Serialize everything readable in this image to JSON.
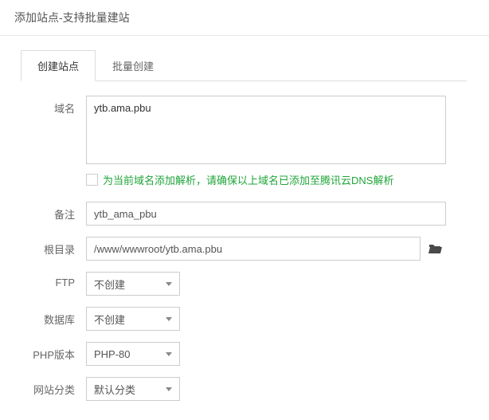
{
  "dialog": {
    "title": "添加站点-支持批量建站"
  },
  "tabs": {
    "create": "创建站点",
    "batch": "批量创建"
  },
  "labels": {
    "domain": "域名",
    "remark": "备注",
    "root": "根目录",
    "ftp": "FTP",
    "db": "数据库",
    "php": "PHP版本",
    "category": "网站分类"
  },
  "values": {
    "domain": "ytb.ama.pbu",
    "remark": "ytb_ama_pbu",
    "root": "/www/wwwroot/ytb.ama.pbu",
    "ftp": "不创建",
    "db": "不创建",
    "php": "PHP-80",
    "category": "默认分类"
  },
  "dns_hint": "为当前域名添加解析，请确保以上域名已添加至腾讯云DNS解析"
}
